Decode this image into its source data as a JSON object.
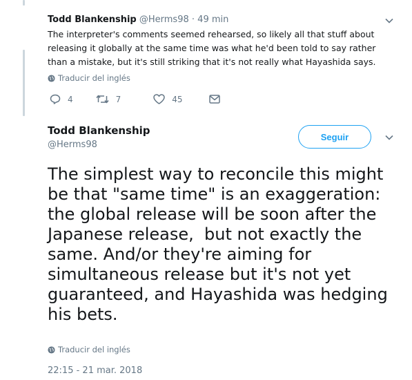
{
  "parent_tweet": {
    "author_name": "Todd Blankenship",
    "handle": "@Herms98",
    "separator": "·",
    "time": "49 min",
    "text": "The interpreter's comments seemed rehearsed, so likely all that stuff about releasing it globally at the same time was what he'd been told to say rather than a mistake, but it's still striking that it's not really what Hayashida says.",
    "translate_label": "Traducir del inglés",
    "reply_count": "4",
    "retweet_count": "7",
    "like_count": "45"
  },
  "focus_tweet": {
    "author_name": "Todd Blankenship",
    "handle": "@Herms98",
    "follow_label": "Seguir",
    "text": "The simplest way to reconcile this might be that \"same time\" is an exaggeration: the global release will be soon after the Japanese release,  but not exactly the same. And/or they're aiming for simultaneous release but it's not yet guaranteed, and Hayashida was hedging his bets.",
    "translate_label": "Traducir del inglés",
    "timestamp": "22:15 - 21 mar. 2018"
  },
  "colors": {
    "accent": "#1da1f2",
    "secondary_text": "#657786",
    "thread_line": "#ccd6dd"
  },
  "icons": [
    "reply-icon",
    "retweet-icon",
    "like-icon",
    "message-icon",
    "globe-icon",
    "chevron-down-icon"
  ]
}
